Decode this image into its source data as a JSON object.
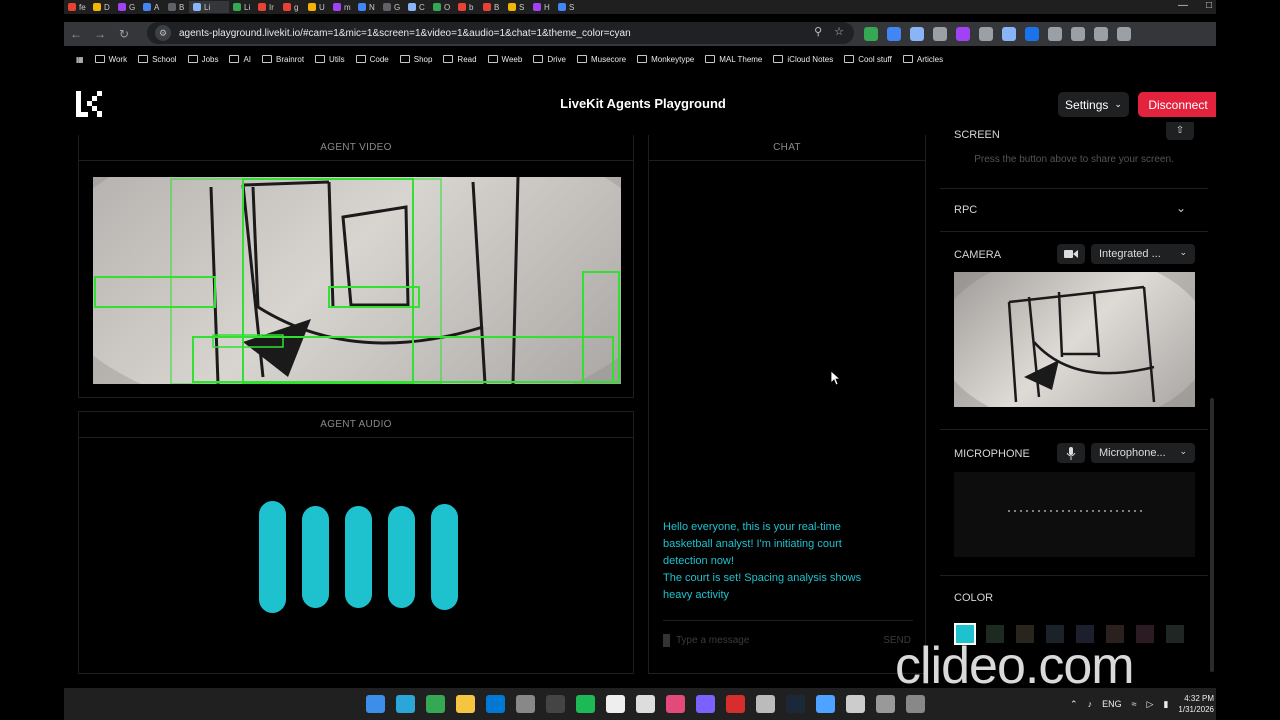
{
  "browser": {
    "tabs": [
      "fe",
      "D",
      "G",
      "A",
      "B",
      "Li",
      "Li",
      "Ir",
      "g",
      "U",
      "m",
      "N",
      "G",
      "C",
      "O",
      "b",
      "B",
      "S",
      "H",
      "S"
    ],
    "url": "agents-playground.livekit.io/#cam=1&mic=1&screen=1&video=1&audio=1&chat=1&theme_color=cyan",
    "bookmarks": [
      "Work",
      "School",
      "Jobs",
      "AI",
      "Brainrot",
      "Utils",
      "Code",
      "Shop",
      "Read",
      "Weeb",
      "Drive",
      "Musecore",
      "Monkeytype",
      "MAL Theme",
      "iCloud Notes",
      "Cool stuff",
      "Articles"
    ],
    "extension_colors": [
      "#34a853",
      "#4285f4",
      "#8ab4f8",
      "#9aa0a6",
      "#a142f4",
      "#9aa0a6",
      "#8ab4f8",
      "#1a73e8",
      "#9aa0a6",
      "#9aa0a6",
      "#9aa0a6",
      "#9aa0a6"
    ]
  },
  "app": {
    "title": "LiveKit Agents Playground",
    "settings_label": "Settings",
    "disconnect_label": "Disconnect",
    "accent": "#1ec2cf",
    "danger": "#e3233d"
  },
  "agent_video": {
    "header": "AGENT VIDEO"
  },
  "agent_audio": {
    "header": "AGENT AUDIO",
    "bar_levels": [
      1.0,
      0.91,
      0.91,
      0.91,
      0.95
    ]
  },
  "chat": {
    "header": "CHAT",
    "messages": [
      "Hello everyone, this is your real-time basketball analyst! I'm initiating court detection now!",
      "The court is set! Spacing analysis shows heavy activity"
    ],
    "input_placeholder": "Type a message",
    "send_label": "SEND"
  },
  "sidebar": {
    "screen": {
      "title": "SCREEN",
      "hint": "Press the button above to share your screen."
    },
    "rpc": {
      "title": "RPC"
    },
    "camera": {
      "title": "CAMERA",
      "device": "Integrated ..."
    },
    "microphone": {
      "title": "MICROPHONE",
      "device": "Microphone..."
    },
    "color": {
      "title": "COLOR",
      "swatches": [
        "#1ec2cf",
        "#1c2a1f",
        "#2a251c",
        "#1c2229",
        "#1d1f2e",
        "#2a201d",
        "#2a1c22",
        "#1f2624"
      ]
    }
  },
  "watermark": "clideo.com",
  "taskbar": {
    "icon_colors": [
      "#3b8eea",
      "#2aa7d8",
      "#34a853",
      "#f5c542",
      "#0078d4",
      "#888888",
      "#444444",
      "#1db954",
      "#eeeeee",
      "#dddddd",
      "#e24a7a",
      "#7b61ff",
      "#d62d2d",
      "#bbbbbb",
      "#1b2838",
      "#4da3ff",
      "#cccccc",
      "#999999",
      "#888888"
    ],
    "language": "ENG",
    "time": "4:32 PM",
    "date": "1/31/2026"
  }
}
